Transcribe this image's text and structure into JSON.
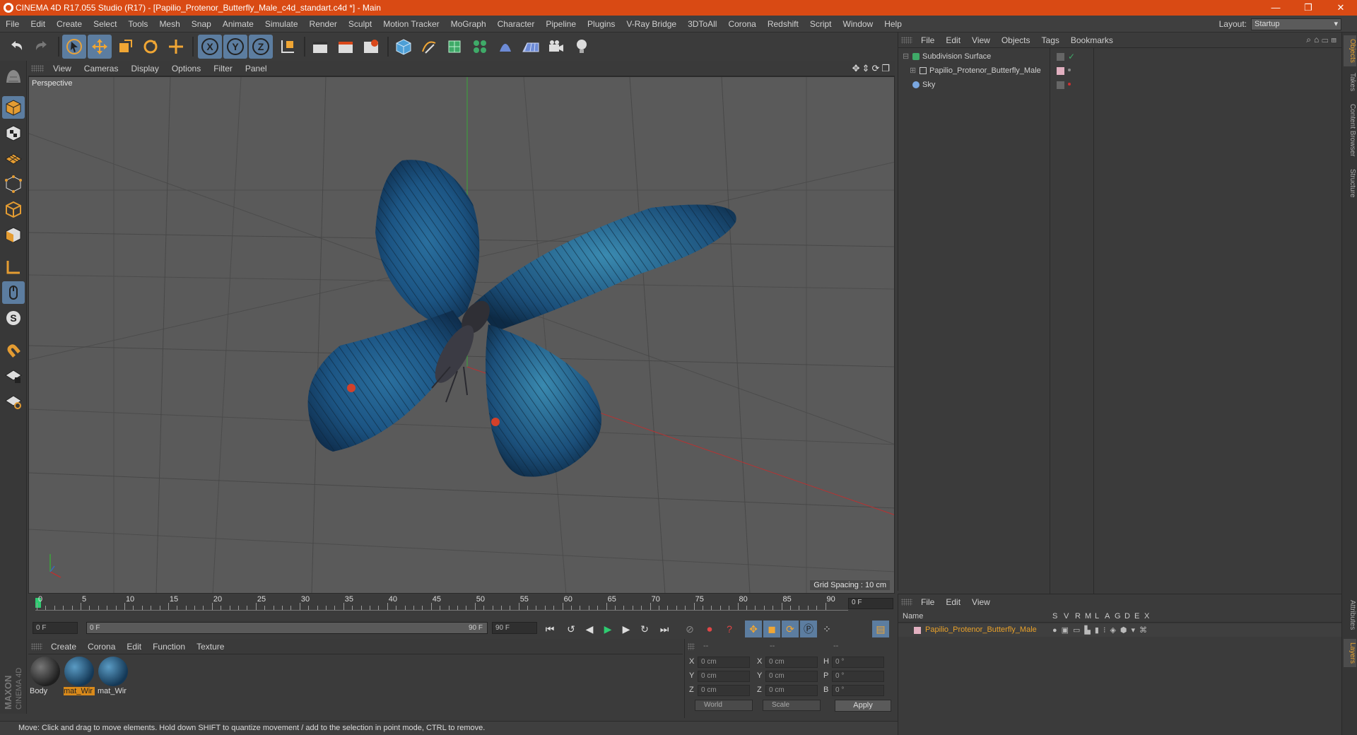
{
  "window": {
    "title": "CINEMA 4D R17.055 Studio (R17) - [Papilio_Protenor_Butterfly_Male_c4d_standart.c4d *] - Main",
    "minimize": "—",
    "restore": "❐",
    "close": "✕"
  },
  "menu": [
    "File",
    "Edit",
    "Create",
    "Select",
    "Tools",
    "Mesh",
    "Snap",
    "Animate",
    "Simulate",
    "Render",
    "Sculpt",
    "Motion Tracker",
    "MoGraph",
    "Character",
    "Pipeline",
    "Plugins",
    "V-Ray Bridge",
    "3DToAll",
    "Corona",
    "Redshift",
    "Script",
    "Window",
    "Help"
  ],
  "layout": {
    "label": "Layout:",
    "value": "Startup"
  },
  "toolbar": {
    "icons": [
      "undo-icon",
      "redo-icon",
      "select-arrow-icon",
      "move-icon",
      "scale-icon",
      "rotate-icon",
      "live-select-icon",
      "x-axis-icon",
      "y-axis-icon",
      "z-axis-icon",
      "coordinate-system-icon",
      "render-view-icon",
      "render-picture-viewer-icon",
      "render-settings-icon",
      "cube-icon",
      "pen-spline-icon",
      "subdivision-icon",
      "mograph-cloner-icon",
      "deformer-icon",
      "floor-icon",
      "camera-icon",
      "light-icon"
    ],
    "axis_labels": [
      "X",
      "Y",
      "Z"
    ]
  },
  "left_tools": [
    "make-editable-icon",
    "model-mode-icon",
    "texture-mode-icon",
    "workplane-icon",
    "points-mode-icon",
    "edges-mode-icon",
    "polygons-mode-icon",
    "axis-mode-icon",
    "tweak-mode-icon",
    "solo-icon",
    "snap-magnet-icon",
    "grid-lock-icon",
    "workplane-lock-icon"
  ],
  "viewport": {
    "menu": [
      "View",
      "Cameras",
      "Display",
      "Options",
      "Filter",
      "Panel"
    ],
    "camera_name": "Perspective",
    "grid_spacing": "Grid Spacing : 10 cm"
  },
  "timeline": {
    "ticks": [
      "0",
      "5",
      "10",
      "15",
      "20",
      "25",
      "30",
      "35",
      "40",
      "45",
      "50",
      "55",
      "60",
      "65",
      "70",
      "75",
      "80",
      "85",
      "90"
    ],
    "current_frame": "0 F",
    "start_field": "0 F",
    "range_start": "0 F",
    "range_end": "90 F",
    "end_field": "90 F"
  },
  "materials": {
    "menu": [
      "Create",
      "Corona",
      "Edit",
      "Function",
      "Texture"
    ],
    "items": [
      {
        "name": "Body",
        "selected": false
      },
      {
        "name": "mat_Wir",
        "selected": true
      },
      {
        "name": "mat_Wir",
        "selected": false
      }
    ]
  },
  "coordinates": {
    "col_headers": [
      "--",
      "--",
      "--"
    ],
    "rows": [
      {
        "a": "X",
        "av": "0 cm",
        "b": "X",
        "bv": "0 cm",
        "c": "H",
        "cv": "0 °"
      },
      {
        "a": "Y",
        "av": "0 cm",
        "b": "Y",
        "bv": "0 cm",
        "c": "P",
        "cv": "0 °"
      },
      {
        "a": "Z",
        "av": "0 cm",
        "b": "Z",
        "bv": "0 cm",
        "c": "B",
        "cv": "0 °"
      }
    ],
    "space": "World",
    "mode": "Scale",
    "apply": "Apply"
  },
  "status": "Move: Click and drag to move elements. Hold down SHIFT to quantize movement / add to the selection in point mode, CTRL to remove.",
  "objects": {
    "menu": [
      "File",
      "Edit",
      "View",
      "Objects",
      "Tags",
      "Bookmarks"
    ],
    "items": [
      {
        "name": "Subdivision Surface",
        "indent": 0
      },
      {
        "name": "Papilio_Protenor_Butterfly_Male",
        "indent": 1
      },
      {
        "name": "Sky",
        "indent": 0
      }
    ]
  },
  "layers": {
    "menu": [
      "File",
      "Edit",
      "View"
    ],
    "headers": [
      "Name",
      "S",
      "V",
      "R",
      "M",
      "L",
      "A",
      "G",
      "D",
      "E",
      "X"
    ],
    "row": "Papilio_Protenor_Butterfly_Male"
  },
  "side_tabs": {
    "top": [
      "Objects",
      "Takes",
      "Content Browser",
      "Structure"
    ],
    "bottom": [
      "Attributes",
      "Layers"
    ]
  },
  "brand": {
    "maxon": "MAXON",
    "c4d": "CINEMA 4D"
  },
  "colors": {
    "title_bar": "#d94a14",
    "active_tool": "#5c7da0",
    "selected_material": "#d98a1b",
    "layer_name": "#e8a12a"
  }
}
